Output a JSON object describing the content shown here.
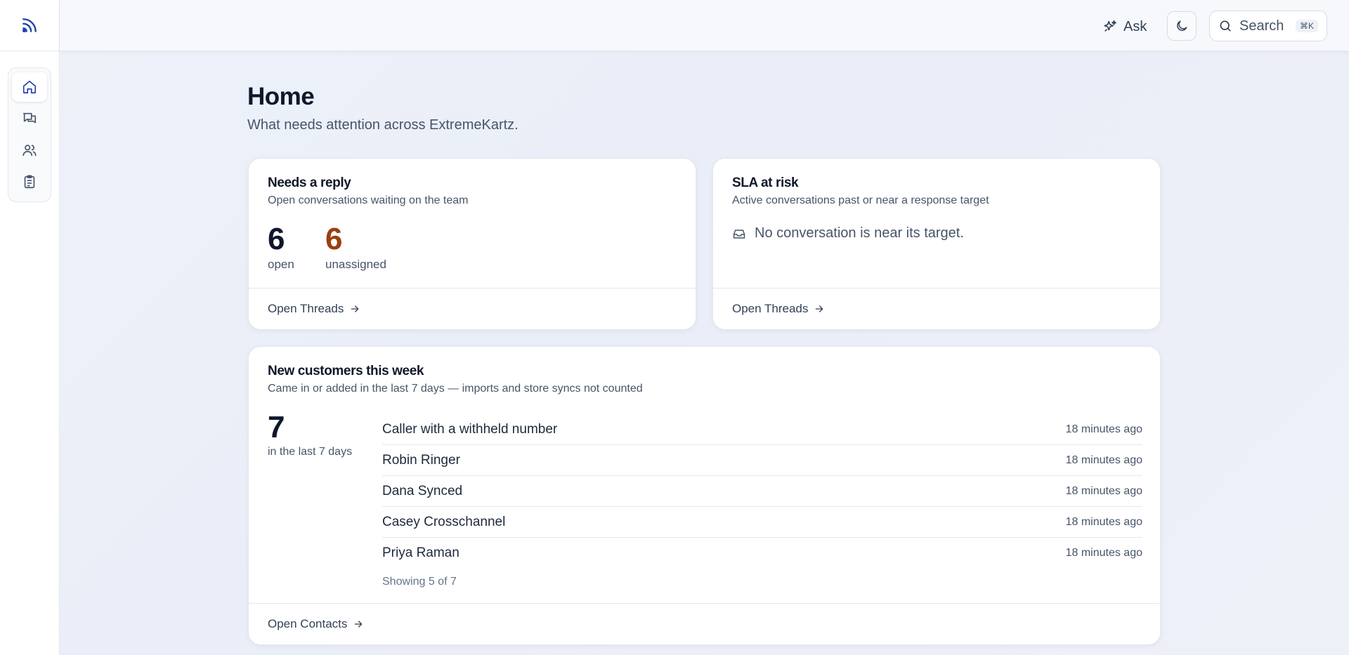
{
  "topbar": {
    "ask_label": "Ask",
    "search_label": "Search",
    "search_shortcut": "⌘K"
  },
  "sidebar": {
    "items": [
      {
        "icon": "home-icon",
        "active": true
      },
      {
        "icon": "chat-bubbles-icon",
        "active": false
      },
      {
        "icon": "users-icon",
        "active": false
      },
      {
        "icon": "clipboard-icon",
        "active": false
      }
    ]
  },
  "page": {
    "title": "Home",
    "subtitle": "What needs attention across ExtremeKartz."
  },
  "needs_reply": {
    "title": "Needs a reply",
    "subtitle": "Open conversations waiting on the team",
    "open_count": "6",
    "open_label": "open",
    "unassigned_count": "6",
    "unassigned_label": "unassigned",
    "link_label": "Open Threads"
  },
  "sla": {
    "title": "SLA at risk",
    "subtitle": "Active conversations past or near a response target",
    "empty_text": "No conversation is near its target.",
    "link_label": "Open Threads"
  },
  "new_customers": {
    "title": "New customers this week",
    "subtitle": "Came in or added in the last 7 days — imports and store syncs not counted",
    "count": "7",
    "count_label": "in the last 7 days",
    "rows": [
      {
        "name": "Caller with a withheld number",
        "time": "18 minutes ago"
      },
      {
        "name": "Robin Ringer",
        "time": "18 minutes ago"
      },
      {
        "name": "Dana Synced",
        "time": "18 minutes ago"
      },
      {
        "name": "Casey Crosschannel",
        "time": "18 minutes ago"
      },
      {
        "name": "Priya Raman",
        "time": "18 minutes ago"
      }
    ],
    "showing": "Showing 5 of 7",
    "link_label": "Open Contacts"
  },
  "colors": {
    "brand": "#1e40af",
    "unassigned": "#9a3f0f"
  }
}
